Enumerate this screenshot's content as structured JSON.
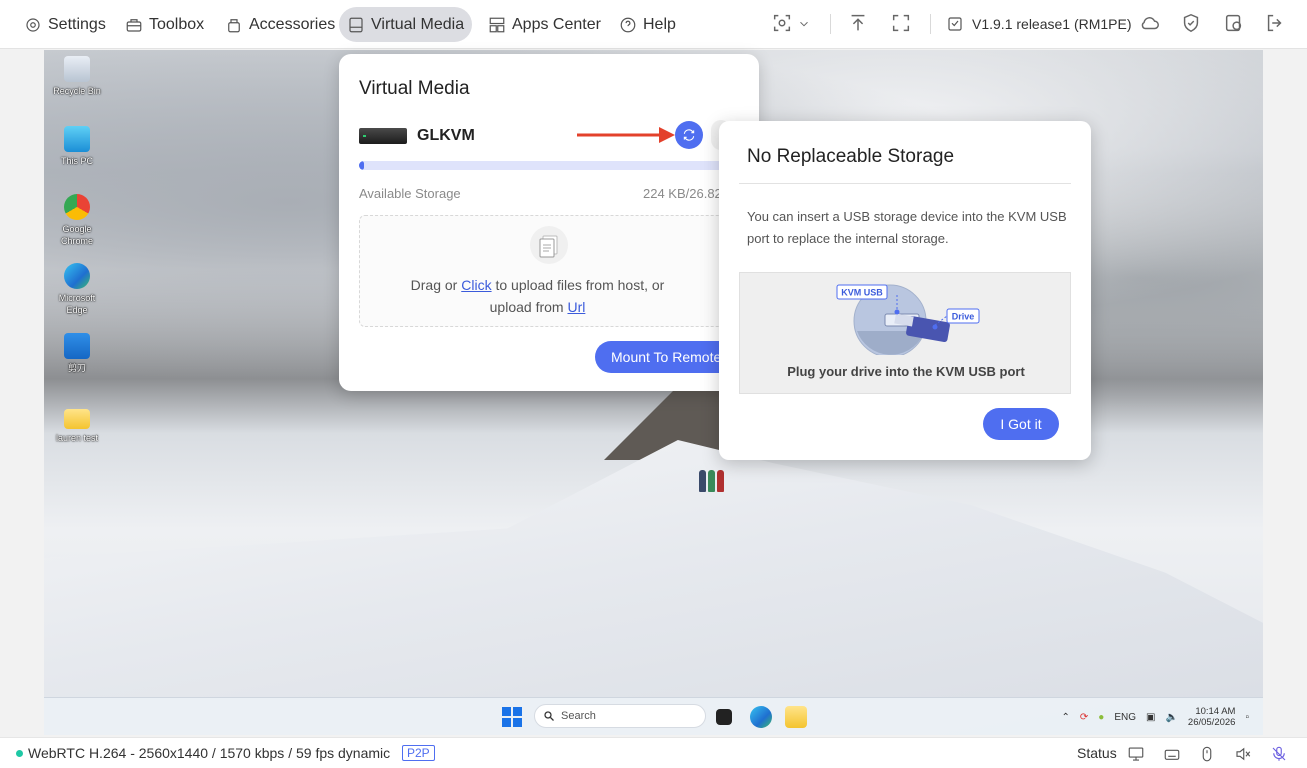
{
  "topbar": {
    "nav": [
      {
        "label": "Settings",
        "icon": "gear-icon"
      },
      {
        "label": "Toolbox",
        "icon": "toolbox-icon"
      },
      {
        "label": "Accessories",
        "icon": "accessories-icon"
      },
      {
        "label": "Virtual Media",
        "icon": "disk-icon",
        "active": true
      },
      {
        "label": "Apps Center",
        "icon": "apps-icon"
      },
      {
        "label": "Help",
        "icon": "help-icon"
      }
    ],
    "version": "V1.9.1 release1 (RM1PE)"
  },
  "desktop": {
    "icons": [
      {
        "label": "Recycle Bin"
      },
      {
        "label": "This PC"
      },
      {
        "label": "Google Chrome"
      },
      {
        "label": "Microsoft Edge"
      },
      {
        "label": "剪刀"
      },
      {
        "label": "lauren test"
      }
    ],
    "taskbar": {
      "search_label": "Search",
      "language": "ENG",
      "time": "10:14 AM",
      "date": "26/05/2026"
    }
  },
  "virtual_media": {
    "title": "Virtual Media",
    "drive_name": "GLKVM",
    "storage_label": "Available Storage",
    "storage_value": "224 KB/26.82",
    "storage_used_fraction": 0.01,
    "drop_prefix": "Drag or ",
    "drop_click": "Click",
    "drop_mid": " to upload files from host, or",
    "drop_line2": "upload from ",
    "drop_url": "Url",
    "mount_button": "Mount To Remote"
  },
  "popover": {
    "title": "No Replaceable Storage",
    "body": "You can insert a USB storage device into the KVM USB port to replace the internal storage.",
    "illus_kvm_label": "KVM USB",
    "illus_drive_label": "Drive",
    "caption": "Plug your drive into the KVM USB port",
    "button": "I Got it"
  },
  "statusbar": {
    "connection": "WebRTC H.264 - 2560x1440 / 1570 kbps / 59 fps dynamic",
    "badge": "P2P",
    "status_label": "Status"
  },
  "colors": {
    "accent": "#4f6ef0",
    "status_ok": "#1ec8a5",
    "arrow": "#e3412b"
  }
}
